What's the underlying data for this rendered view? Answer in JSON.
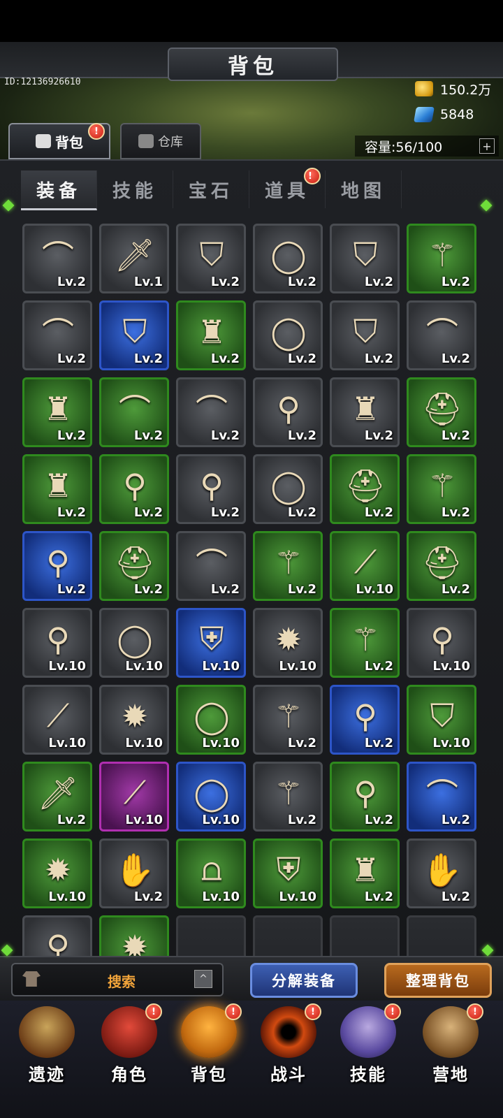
{
  "header": {
    "title": "背包",
    "player_id": "ID:12136926610",
    "gold": "150.2万",
    "gems": "5848",
    "capacity": "容量:56/100",
    "capacity_plus": "+"
  },
  "bag_tabs": [
    {
      "label": "背包",
      "active": true,
      "badge": "!"
    },
    {
      "label": "仓库",
      "active": false
    }
  ],
  "category_tabs": [
    {
      "label": "装备",
      "active": true
    },
    {
      "label": "技能",
      "active": false
    },
    {
      "label": "宝石",
      "active": false
    },
    {
      "label": "道具",
      "active": false,
      "badge": "!"
    },
    {
      "label": "地图",
      "active": false
    }
  ],
  "items": [
    {
      "icon": "bow-icon",
      "rarity": "gray",
      "level": "Lv.2"
    },
    {
      "icon": "sword-icon",
      "rarity": "gray",
      "level": "Lv.1"
    },
    {
      "icon": "pants-icon",
      "rarity": "gray",
      "level": "Lv.2"
    },
    {
      "icon": "ring-icon",
      "rarity": "gray",
      "level": "Lv.2"
    },
    {
      "icon": "pants-icon",
      "rarity": "gray",
      "level": "Lv.2"
    },
    {
      "icon": "staff-icon",
      "rarity": "green",
      "level": "Lv.2"
    },
    {
      "icon": "bow-icon",
      "rarity": "gray",
      "level": "Lv.2"
    },
    {
      "icon": "pants-icon",
      "rarity": "blue",
      "level": "Lv.2"
    },
    {
      "icon": "robe-icon",
      "rarity": "green",
      "level": "Lv.2"
    },
    {
      "icon": "ring-icon",
      "rarity": "gray",
      "level": "Lv.2"
    },
    {
      "icon": "pants-icon",
      "rarity": "gray",
      "level": "Lv.2"
    },
    {
      "icon": "bow-icon",
      "rarity": "gray",
      "level": "Lv.2"
    },
    {
      "icon": "robe-icon",
      "rarity": "green",
      "level": "Lv.2"
    },
    {
      "icon": "bow-icon",
      "rarity": "green",
      "level": "Lv.2"
    },
    {
      "icon": "bow-icon",
      "rarity": "gray",
      "level": "Lv.2"
    },
    {
      "icon": "amulet-icon",
      "rarity": "gray",
      "level": "Lv.2"
    },
    {
      "icon": "robe-icon",
      "rarity": "gray",
      "level": "Lv.2"
    },
    {
      "icon": "helmet-icon",
      "rarity": "green",
      "level": "Lv.2"
    },
    {
      "icon": "robe-icon",
      "rarity": "green",
      "level": "Lv.2"
    },
    {
      "icon": "amulet-icon",
      "rarity": "green",
      "level": "Lv.2"
    },
    {
      "icon": "amulet-icon",
      "rarity": "gray",
      "level": "Lv.2"
    },
    {
      "icon": "ring-icon",
      "rarity": "gray",
      "level": "Lv.2"
    },
    {
      "icon": "helmet-icon",
      "rarity": "green",
      "level": "Lv.2"
    },
    {
      "icon": "staff-icon",
      "rarity": "green",
      "level": "Lv.2"
    },
    {
      "icon": "amulet-icon",
      "rarity": "blue",
      "level": "Lv.2"
    },
    {
      "icon": "helmet-icon",
      "rarity": "green",
      "level": "Lv.2"
    },
    {
      "icon": "bow-icon",
      "rarity": "gray",
      "level": "Lv.2"
    },
    {
      "icon": "staff-icon",
      "rarity": "green",
      "level": "Lv.2"
    },
    {
      "icon": "spear-icon",
      "rarity": "green",
      "level": "Lv.10"
    },
    {
      "icon": "helmet-icon",
      "rarity": "green",
      "level": "Lv.2"
    },
    {
      "icon": "amulet-icon",
      "rarity": "gray",
      "level": "Lv.10"
    },
    {
      "icon": "ring-icon",
      "rarity": "gray",
      "level": "Lv.10"
    },
    {
      "icon": "armor-icon",
      "rarity": "blue",
      "level": "Lv.10"
    },
    {
      "icon": "mace-icon",
      "rarity": "gray",
      "level": "Lv.10"
    },
    {
      "icon": "staff-icon",
      "rarity": "green",
      "level": "Lv.2"
    },
    {
      "icon": "amulet-icon",
      "rarity": "gray",
      "level": "Lv.10"
    },
    {
      "icon": "spear-icon",
      "rarity": "gray",
      "level": "Lv.10"
    },
    {
      "icon": "mace-icon",
      "rarity": "gray",
      "level": "Lv.10"
    },
    {
      "icon": "ring-icon",
      "rarity": "green",
      "level": "Lv.10"
    },
    {
      "icon": "staff-icon",
      "rarity": "gray",
      "level": "Lv.2"
    },
    {
      "icon": "amulet-icon",
      "rarity": "blue",
      "level": "Lv.2"
    },
    {
      "icon": "pants-icon",
      "rarity": "green",
      "level": "Lv.10"
    },
    {
      "icon": "sword-icon",
      "rarity": "green",
      "level": "Lv.2"
    },
    {
      "icon": "spear-icon",
      "rarity": "purple",
      "level": "Lv.10"
    },
    {
      "icon": "ring-icon",
      "rarity": "blue",
      "level": "Lv.10"
    },
    {
      "icon": "staff-icon",
      "rarity": "gray",
      "level": "Lv.2"
    },
    {
      "icon": "amulet-icon",
      "rarity": "green",
      "level": "Lv.2"
    },
    {
      "icon": "bow-icon",
      "rarity": "blue",
      "level": "Lv.2"
    },
    {
      "icon": "mace-icon",
      "rarity": "green",
      "level": "Lv.10"
    },
    {
      "icon": "gloves-icon",
      "rarity": "gray",
      "level": "Lv.2"
    },
    {
      "icon": "greaves-icon",
      "rarity": "green",
      "level": "Lv.10"
    },
    {
      "icon": "armor-icon",
      "rarity": "green",
      "level": "Lv.10"
    },
    {
      "icon": "robe-icon",
      "rarity": "green",
      "level": "Lv.2"
    },
    {
      "icon": "gloves-icon",
      "rarity": "gray",
      "level": "Lv.2"
    },
    {
      "icon": "amulet-icon",
      "rarity": "gray",
      "level": ""
    },
    {
      "icon": "mace-icon",
      "rarity": "green",
      "level": ""
    },
    {
      "icon": "",
      "rarity": "empty",
      "level": ""
    },
    {
      "icon": "",
      "rarity": "empty",
      "level": ""
    },
    {
      "icon": "",
      "rarity": "empty",
      "level": ""
    },
    {
      "icon": "",
      "rarity": "empty",
      "level": ""
    }
  ],
  "footer": {
    "search_label": "搜索",
    "caret": "^",
    "decompose_label": "分解装备",
    "sort_label": "整理背包"
  },
  "nav": [
    {
      "label": "遗迹",
      "icon": "relic-icon",
      "badge": ""
    },
    {
      "label": "角色",
      "icon": "role-icon",
      "badge": "!"
    },
    {
      "label": "背包",
      "icon": "bag-icon",
      "badge": "!"
    },
    {
      "label": "战斗",
      "icon": "battle-icon",
      "badge": "!"
    },
    {
      "label": "技能",
      "icon": "skill-icon",
      "badge": "!"
    },
    {
      "label": "营地",
      "icon": "camp-icon",
      "badge": "!"
    }
  ],
  "glyphs": {
    "bow-icon": "⌒",
    "sword-icon": "🗡",
    "pants-icon": "⛉",
    "ring-icon": "◯",
    "staff-icon": "⚚",
    "robe-icon": "♜",
    "amulet-icon": "⚲",
    "helmet-icon": "⛑",
    "spear-icon": "⟋",
    "mace-icon": "✹",
    "armor-icon": "⛨",
    "gloves-icon": "✋",
    "greaves-icon": "⩍"
  }
}
